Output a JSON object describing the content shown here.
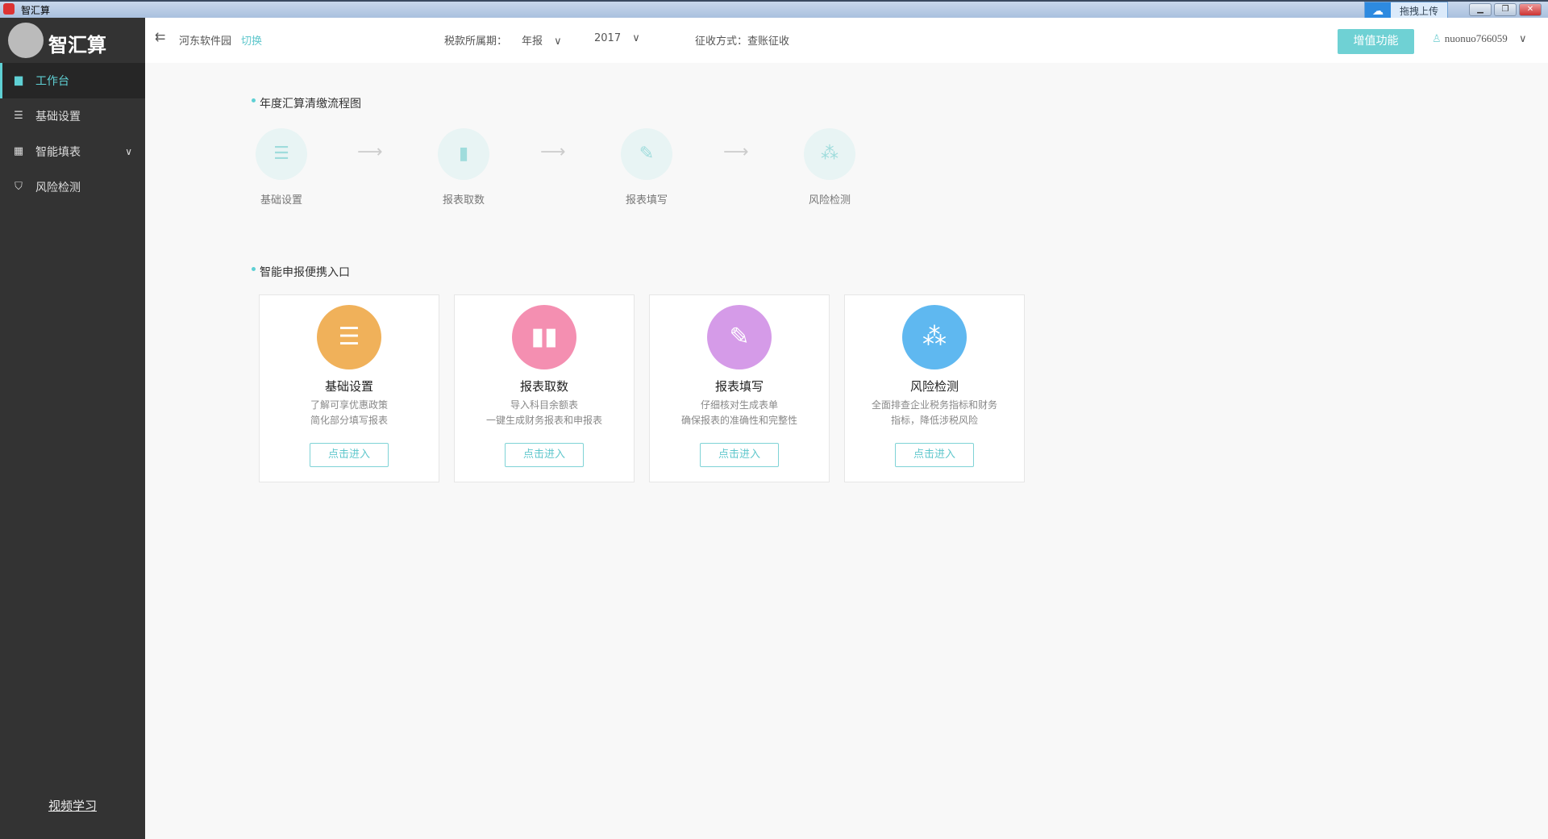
{
  "window": {
    "title": "智汇算",
    "upload_label": "拖拽上传"
  },
  "logo": {
    "name": "智汇算",
    "watermark": "河东软件园",
    "watermark_url": "www.pc0359.cn"
  },
  "sidebar": {
    "items": [
      {
        "label": "工作台",
        "icon": "monitor-icon",
        "active": true
      },
      {
        "label": "基础设置",
        "icon": "list-icon"
      },
      {
        "label": "智能填表",
        "icon": "grid-icon",
        "expandable": true
      },
      {
        "label": "风险检测",
        "icon": "shield-icon"
      }
    ],
    "video_link": "视频学习"
  },
  "header": {
    "company": "河东软件园",
    "switch": "切换",
    "period_label": "税款所属期：",
    "period_type": "年报",
    "year": "2017",
    "collection": "征收方式：查账征收",
    "vip_button": "增值功能",
    "user": "nuonuo766059"
  },
  "flow": {
    "title": "年度汇算清缴流程图",
    "steps": [
      {
        "label": "基础设置",
        "icon": "list-icon"
      },
      {
        "label": "报表取数",
        "icon": "bar-chart-icon"
      },
      {
        "label": "报表填写",
        "icon": "pencil-icon"
      },
      {
        "label": "风险检测",
        "icon": "network-icon"
      }
    ]
  },
  "entry": {
    "title": "智能申报便携入口",
    "cards": [
      {
        "title": "基础设置",
        "desc1": "了解可享优惠政策",
        "desc2": "简化部分填写报表",
        "button": "点击进入",
        "color": "#f0b15a",
        "icon": "list-icon"
      },
      {
        "title": "报表取数",
        "desc1": "导入科目余额表",
        "desc2": "一键生成财务报表和申报表",
        "button": "点击进入",
        "color": "#f48fb1",
        "icon": "bar-chart-icon"
      },
      {
        "title": "报表填写",
        "desc1": "仔细核对生成表单",
        "desc2": "确保报表的准确性和完整性",
        "button": "点击进入",
        "color": "#d59be8",
        "icon": "pencil-icon"
      },
      {
        "title": "风险检测",
        "desc1": "全面排查企业税务指标和财务",
        "desc2": "指标，降低涉税风险",
        "button": "点击进入",
        "color": "#5fb8f0",
        "icon": "network-icon"
      }
    ]
  }
}
